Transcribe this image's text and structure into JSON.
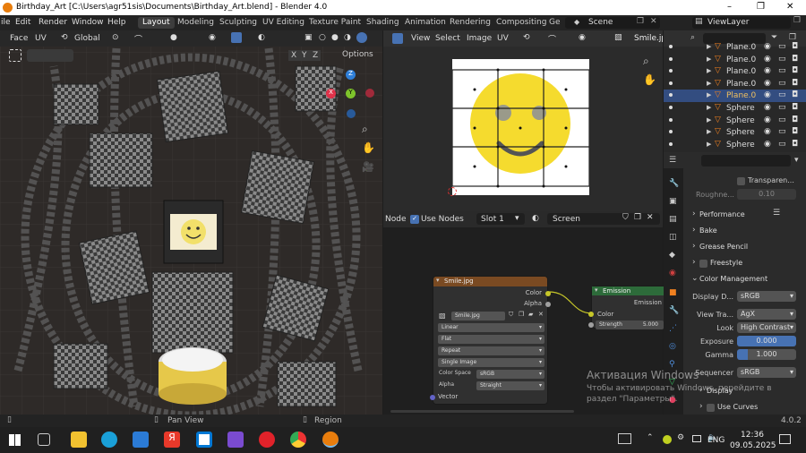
{
  "window": {
    "title": "Birthday_Art [C:\\Users\\agr51sis\\Documents\\Birthday_Art.blend] - Blender 4.0",
    "controls": [
      "–",
      "❐",
      "✕"
    ]
  },
  "menu": [
    "ile",
    "Edit",
    "Render",
    "Window",
    "Help"
  ],
  "workspaces": [
    "Layout",
    "Modeling",
    "Sculpting",
    "UV Editing",
    "Texture Paint",
    "Shading",
    "Animation",
    "Rendering",
    "Compositing",
    "Ge"
  ],
  "scene": {
    "label": "Scene",
    "viewlayer": "ViewLayer"
  },
  "viewport": {
    "mode": "Face",
    "uv": "UV",
    "transform": "Global",
    "options": "Options",
    "axes": [
      "X",
      "Y",
      "Z"
    ],
    "gizmo": {
      "x": "X",
      "y": "Y",
      "z": "Z"
    }
  },
  "image_editor": {
    "menus": [
      "View",
      "Select",
      "Image",
      "UV"
    ],
    "image_name": "Smile.jpg"
  },
  "node_editor": {
    "node": "Node",
    "use_nodes": "Use Nodes",
    "slot": "Slot 1",
    "world": "Screen",
    "image_node": {
      "title": "Smile.jpg",
      "outputs": [
        "Color",
        "Alpha"
      ],
      "image": "Smile.jpg",
      "interpolation": "Linear",
      "projection": "Flat",
      "extension": "Repeat",
      "source": "Single Image",
      "color_space_label": "Color Space",
      "color_space": "sRGB",
      "alpha_label": "Alpha",
      "alpha": "Straight",
      "input": "Vector"
    },
    "emission_node": {
      "title": "Emission",
      "output": "Emission",
      "color": "Color",
      "strength_label": "Strength",
      "strength": "5.000"
    }
  },
  "outliner": {
    "items": [
      {
        "name": "Plane.0",
        "type": "plane",
        "selected": false
      },
      {
        "name": "Plane.0",
        "type": "plane",
        "selected": false
      },
      {
        "name": "Plane.0",
        "type": "plane",
        "selected": false
      },
      {
        "name": "Plane.0",
        "type": "plane",
        "selected": false
      },
      {
        "name": "Plane.0",
        "type": "plane",
        "selected": true
      },
      {
        "name": "Sphere",
        "type": "sphere",
        "selected": false
      },
      {
        "name": "Sphere",
        "type": "sphere",
        "selected": false
      },
      {
        "name": "Sphere",
        "type": "sphere",
        "selected": false
      },
      {
        "name": "Sphere",
        "type": "sphere",
        "selected": false
      }
    ]
  },
  "properties": {
    "transparent": "Transparen...",
    "roughness_label": "Roughne...",
    "roughness": "0.10",
    "performance": "Performance",
    "bake": "Bake",
    "grease_pencil": "Grease Pencil",
    "freestyle": "Freestyle",
    "color_management": "Color Management",
    "display_label": "Display D...",
    "display": "sRGB",
    "view_label": "View Tra...",
    "view": "AgX",
    "look_label": "Look",
    "look": "High Contrast",
    "exposure_label": "Exposure",
    "exposure": "0.000",
    "gamma_label": "Gamma",
    "gamma": "1.000",
    "sequencer_label": "Sequencer",
    "sequencer": "sRGB",
    "display_sub": "Display",
    "use_curves": "Use Curves"
  },
  "activation": {
    "title": "Активация Windows",
    "line1": "Чтобы активировать Windows, перейдите в",
    "line2": "раздел \"Параметры\"."
  },
  "status": {
    "pan": "Pan View",
    "region": "Region",
    "version": "4.0.2"
  },
  "taskbar": {
    "lang": "ENG",
    "time": "12:36",
    "date": "09.05.2025"
  }
}
